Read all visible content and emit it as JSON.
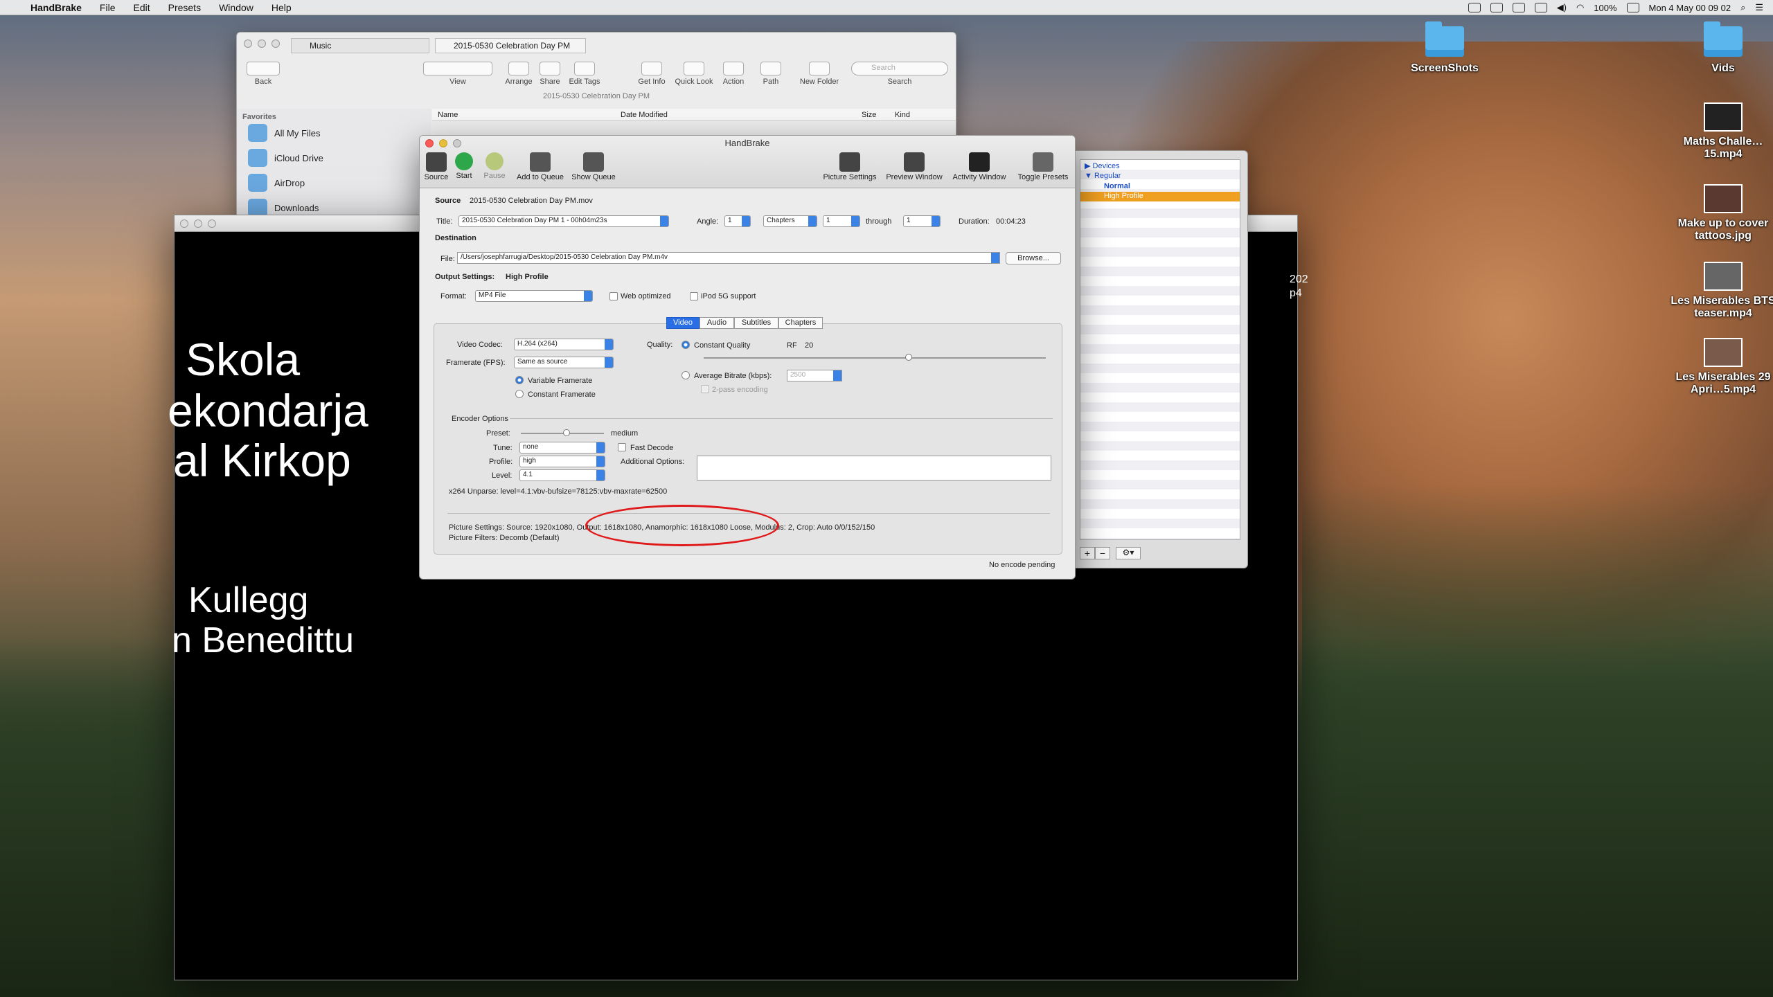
{
  "menubar": {
    "app": "HandBrake",
    "items": [
      "File",
      "Edit",
      "Presets",
      "Window",
      "Help"
    ],
    "battery": "100%",
    "clock": "Mon 4 May  00 09 02"
  },
  "desktop": {
    "icons": [
      {
        "label": "ScreenShots"
      },
      {
        "label": "Vids"
      },
      {
        "label": "Maths Challe…15.mp4"
      },
      {
        "label": "Make up to cover tattoos.jpg"
      },
      {
        "label": "Les Miserables BTS teaser.mp4"
      },
      {
        "label": "Les Miserables 29 Apri…5.mp4"
      }
    ]
  },
  "finder": {
    "tabs": [
      "Music",
      "2015-0530 Celebration Day PM"
    ],
    "toolbar": {
      "back": "Back",
      "view": "View",
      "arrange": "Arrange",
      "share": "Share",
      "edit_tags": "Edit Tags",
      "get_info": "Get Info",
      "quick_look": "Quick Look",
      "action": "Action",
      "path": "Path",
      "new_folder": "New Folder",
      "search_label": "Search",
      "search_placeholder": "Search"
    },
    "path_title": "2015-0530 Celebration Day PM",
    "columns": {
      "name": "Name",
      "date": "Date Modified",
      "size": "Size",
      "kind": "Kind"
    },
    "favorites_header": "Favorites",
    "favorites": [
      "All My Files",
      "iCloud Drive",
      "AirDrop",
      "Downloads"
    ]
  },
  "handbrake": {
    "window_title": "HandBrake",
    "toolbar": {
      "source": "Source",
      "start": "Start",
      "pause": "Pause",
      "add_to_queue": "Add to Queue",
      "show_queue": "Show Queue",
      "picture_settings": "Picture Settings",
      "preview_window": "Preview Window",
      "activity_window": "Activity Window",
      "toggle_presets": "Toggle Presets"
    },
    "source_label": "Source",
    "source_value": "2015-0530 Celebration Day PM.mov",
    "title_label": "Title:",
    "title_value": "2015-0530 Celebration Day PM 1 - 00h04m23s",
    "angle_label": "Angle:",
    "angle_value": "1",
    "range_type": "Chapters",
    "range_from": "1",
    "through_label": "through",
    "range_to": "1",
    "duration_label": "Duration:",
    "duration_value": "00:04:23",
    "destination_label": "Destination",
    "file_label": "File:",
    "file_value": "/Users/josephfarrugia/Desktop/2015-0530 Celebration Day PM.m4v",
    "browse": "Browse...",
    "output_settings_label": "Output Settings:",
    "output_settings_value": "High Profile",
    "format_label": "Format:",
    "format_value": "MP4 File",
    "web_optimized": "Web optimized",
    "ipod_support": "iPod 5G support",
    "tabs": [
      "Video",
      "Audio",
      "Subtitles",
      "Chapters"
    ],
    "video_codec_label": "Video Codec:",
    "video_codec_value": "H.264 (x264)",
    "framerate_label": "Framerate (FPS):",
    "framerate_value": "Same as source",
    "variable_framerate": "Variable Framerate",
    "constant_framerate": "Constant Framerate",
    "quality_label": "Quality:",
    "constant_quality": "Constant Quality",
    "rf_label": "RF",
    "rf_value": "20",
    "quality_slider_level": 0.6,
    "average_bitrate": "Average Bitrate (kbps):",
    "bitrate_placeholder": "2500",
    "two_pass": "2-pass encoding",
    "encoder_options": "Encoder Options",
    "preset_label": "Preset:",
    "preset_value": "medium",
    "preset_slider_level": 0.55,
    "tune_label": "Tune:",
    "tune_value": "none",
    "fast_decode": "Fast Decode",
    "profile_label": "Profile:",
    "profile_value": "high",
    "additional_options": "Additional Options:",
    "level_label": "Level:",
    "level_value": "4.1",
    "unparse": "x264 Unparse: level=4.1:vbv-bufsize=78125:vbv-maxrate=62500",
    "picture_settings_line_a": "Picture Settings: Source: 1920x1080, ",
    "picture_settings_line_b": "Output: 1618x1080, Anamorphic: 1618x1080 Loose",
    "picture_settings_line_c": ", Modulus: 2, Crop: Auto 0/0/152/150",
    "picture_filters": "Picture Filters: Decomb (Default)",
    "status": "No encode pending"
  },
  "presets": {
    "groups": [
      {
        "name": "Devices"
      },
      {
        "name": "Regular",
        "items": [
          "Normal",
          "High Profile"
        ]
      }
    ],
    "selected": "High Profile"
  },
  "movie": {
    "lines_top": [
      "Skola",
      "ekondarja",
      "al Kirkop"
    ],
    "lines_bottom": [
      "Kullegg",
      "n Benedittu"
    ],
    "side_fragments": [
      "202",
      "p4"
    ]
  },
  "colors": {
    "accent": "#2a6ee6",
    "highlight": "#f0a020",
    "annotation": "#e01a1a"
  }
}
